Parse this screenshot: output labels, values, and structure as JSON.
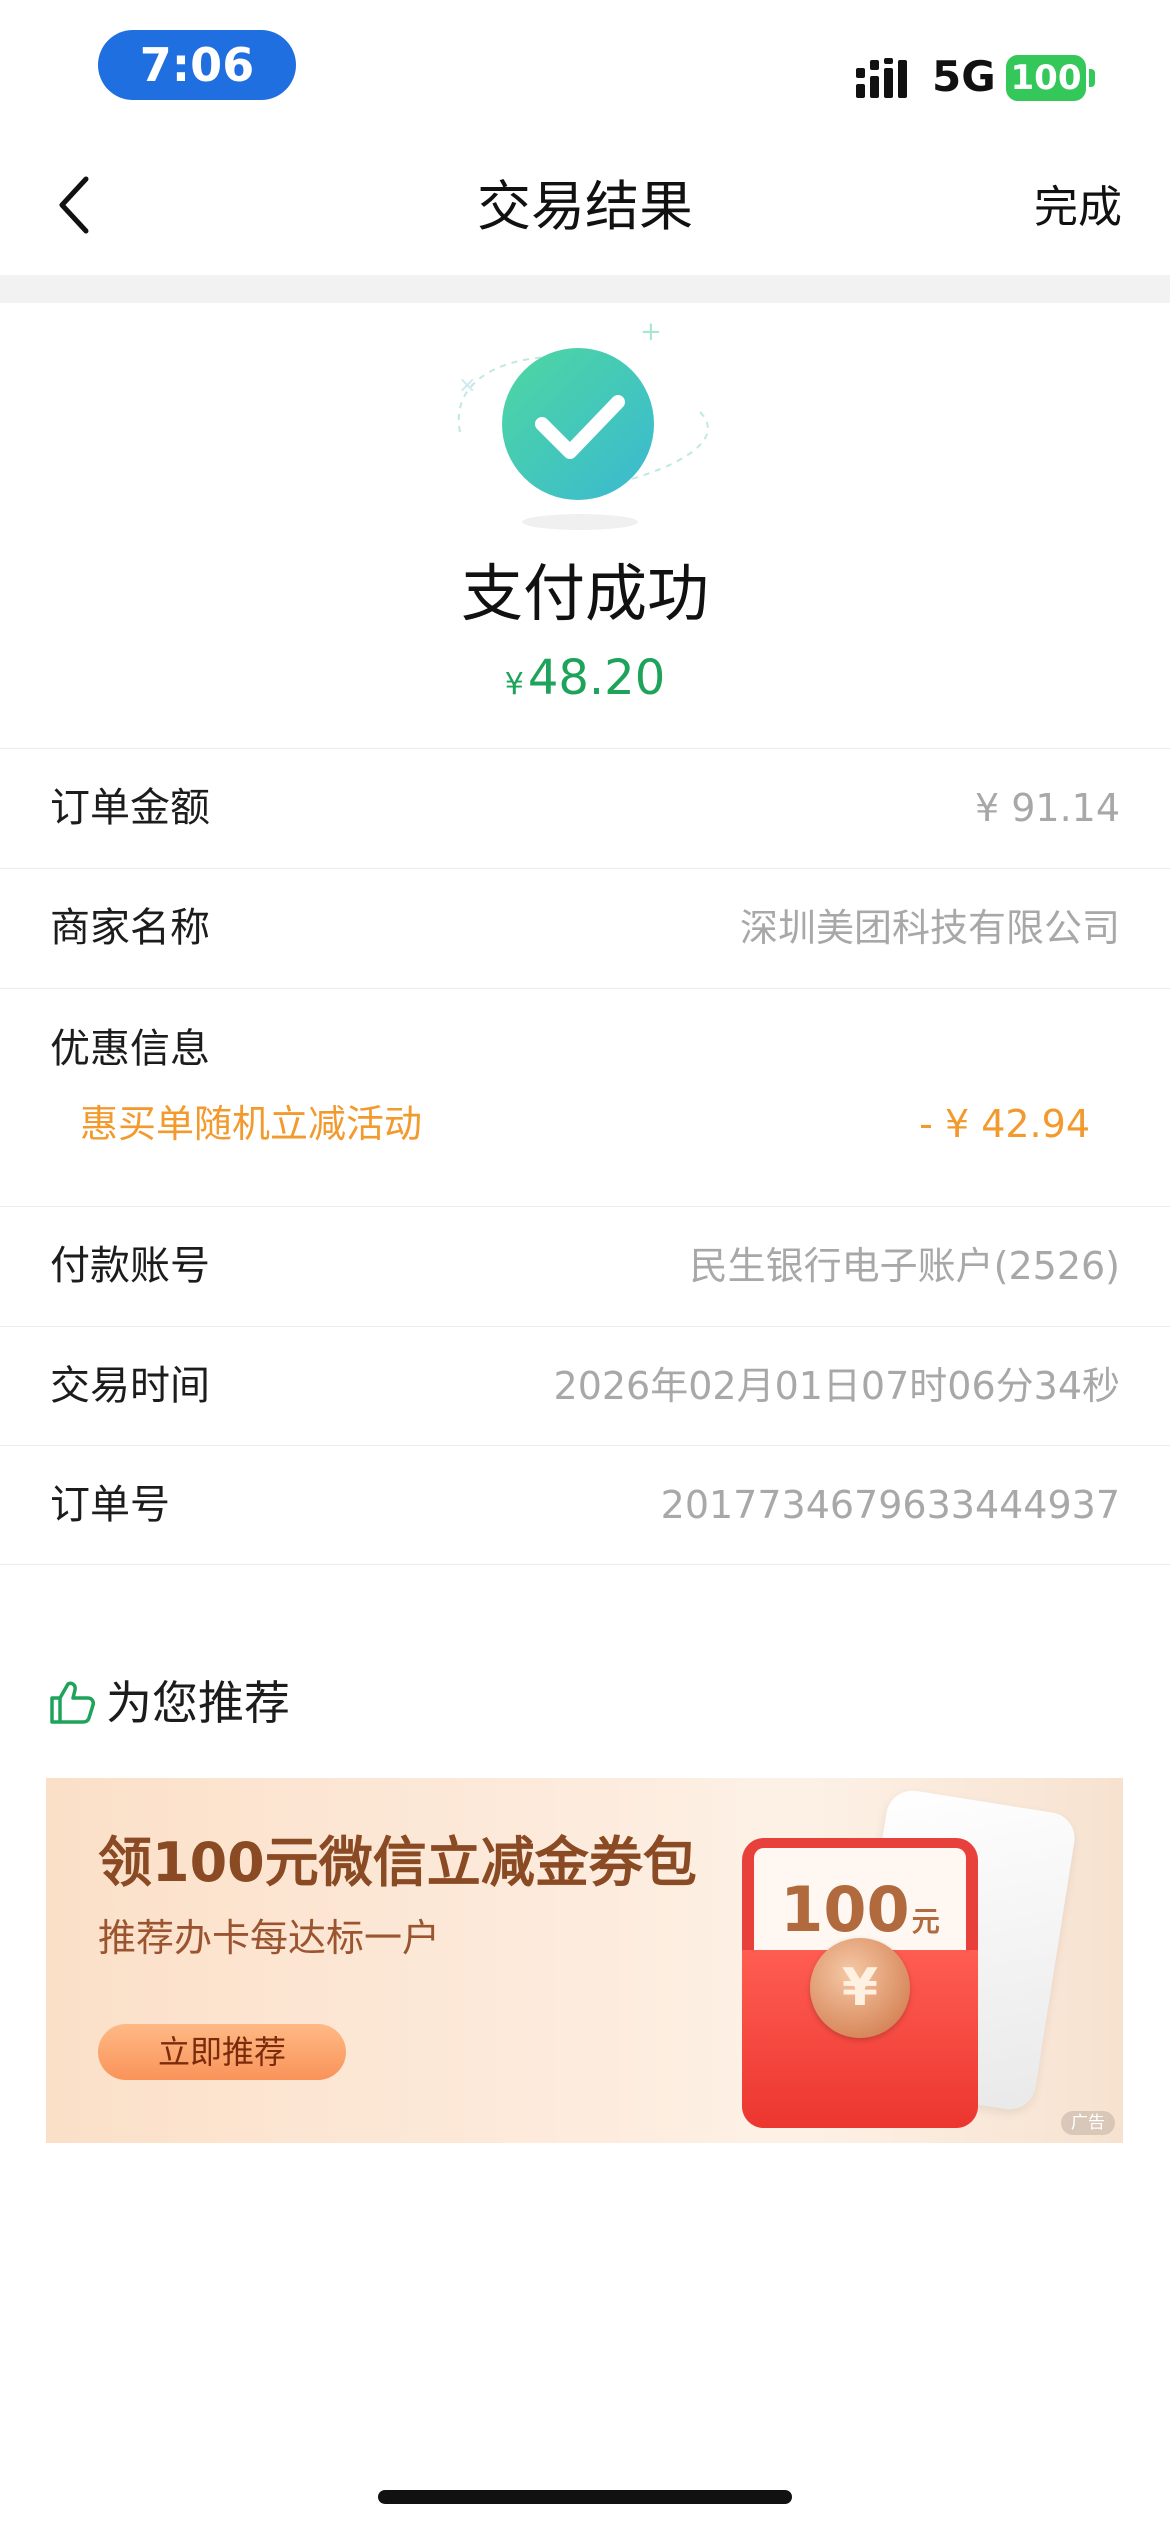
{
  "status_bar": {
    "time": "7:06",
    "network": "5G",
    "battery": "100"
  },
  "nav": {
    "title": "交易结果",
    "done_label": "完成"
  },
  "result": {
    "title": "支付成功",
    "currency": "¥",
    "amount": "48.20",
    "accent_color": "#1ea35a"
  },
  "details": {
    "order_amount": {
      "label": "订单金额",
      "value": "¥ 91.14"
    },
    "merchant": {
      "label": "商家名称",
      "value": "深圳美团科技有限公司"
    },
    "promotion": {
      "label": "优惠信息",
      "name": "惠买单随机立减活动",
      "amount": "- ¥ 42.94",
      "color": "#f29a2e"
    },
    "account": {
      "label": "付款账号",
      "value": "民生银行电子账户(2526)"
    },
    "time": {
      "label": "交易时间",
      "value": "2026年02月01日07时06分34秒"
    },
    "order_no": {
      "label": "订单号",
      "value": "2017734679633444937"
    }
  },
  "recommend": {
    "title": "为您推荐",
    "icon": "thumbs-up-icon",
    "banner": {
      "title": "领100元微信立减金券包",
      "subtitle": "推荐办卡每达标一户",
      "button": "立即推荐",
      "coupon_value": "100",
      "coupon_unit": "元",
      "coin_symbol": "¥",
      "ad_label": "广告"
    }
  }
}
